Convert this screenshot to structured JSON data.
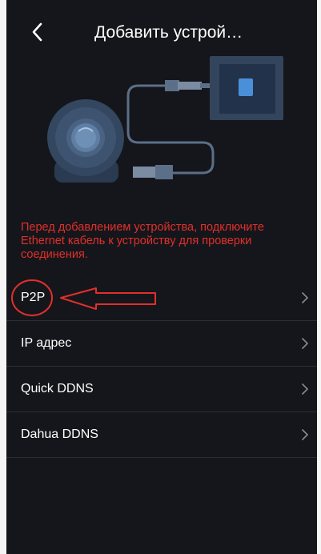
{
  "header": {
    "title": "Добавить устрой…",
    "back_icon": "chevron-left-icon"
  },
  "illustration": {
    "icons": [
      "camera-icon",
      "ethernet-cable-icon",
      "router-icon"
    ]
  },
  "warning": {
    "text": "Перед добавлением устройства, подключите Ethernet кабель к устройству для проверки соединения.",
    "color": "#e0302b"
  },
  "menu": {
    "items": [
      {
        "label": "P2P"
      },
      {
        "label": "IP адрес"
      },
      {
        "label": "Quick DDNS"
      },
      {
        "label": "Dahua DDNS"
      }
    ],
    "chevron_icon": "chevron-right-icon"
  },
  "annotation": {
    "color": "#e0302b",
    "shapes": [
      "circle",
      "arrow-left"
    ]
  },
  "colors": {
    "background": "#15161b",
    "text": "#ffffff",
    "divider": "#2c2e35",
    "illustration": "#2b3a4f",
    "accent": "#4a90d9"
  }
}
